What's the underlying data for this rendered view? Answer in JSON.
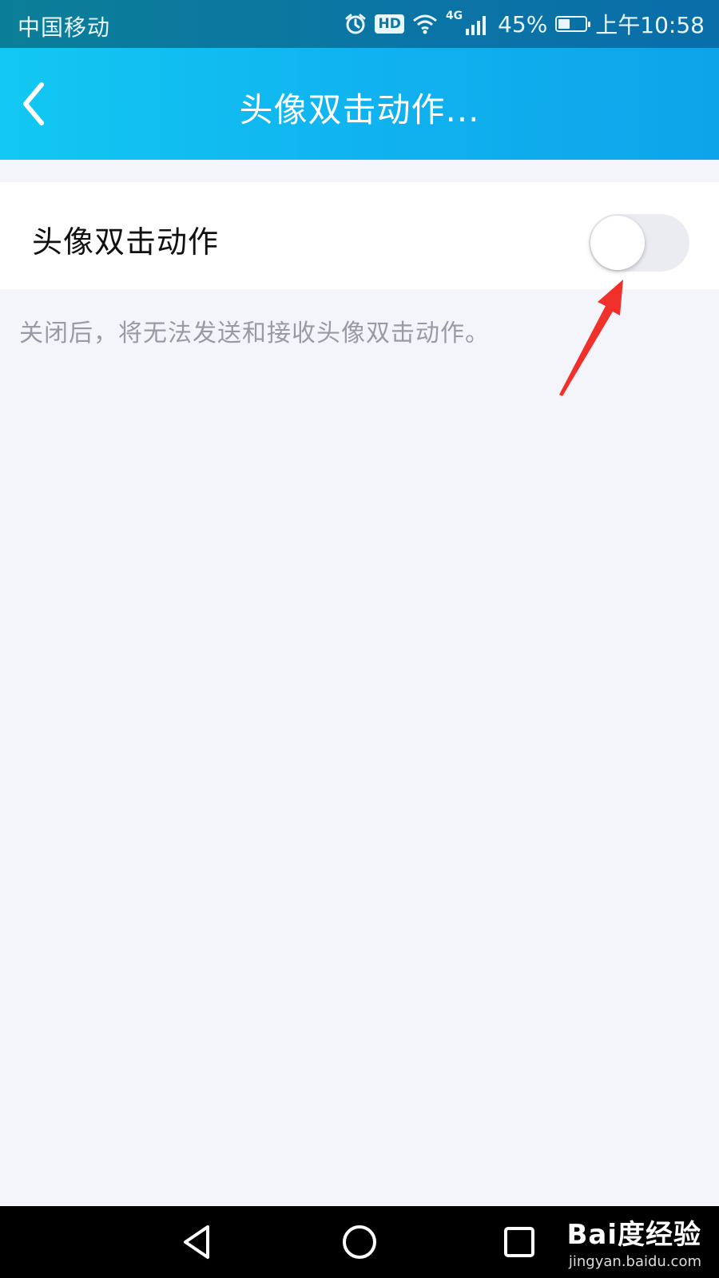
{
  "status_bar": {
    "carrier": "中国移动",
    "network": "4G",
    "hd_label": "HD",
    "battery_percent": "45%",
    "battery_level": 0.45,
    "time": "上午10:58",
    "icons": [
      "alarm-icon",
      "hd-icon",
      "wifi-icon",
      "signal-icon",
      "battery-icon"
    ]
  },
  "header": {
    "title": "头像双击动作...",
    "back_icon": "chevron-left-icon"
  },
  "setting": {
    "label": "头像双击动作",
    "enabled": false,
    "hint": "关闭后，将无法发送和接收头像双击动作。"
  },
  "annotation": {
    "color": "#f0302a"
  },
  "nav_bar": {
    "buttons": [
      "back-triangle-icon",
      "home-circle-icon",
      "recents-square-icon"
    ]
  },
  "watermark": {
    "brand": "Bai度经验",
    "url": "jingyan.baidu.com"
  },
  "colors": {
    "header_start": "#12c8f2",
    "header_end": "#0ea4ea",
    "background": "#f4f4fb"
  }
}
